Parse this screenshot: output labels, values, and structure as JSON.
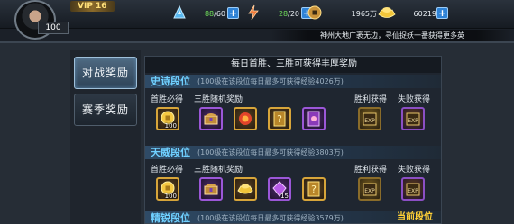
{
  "player": {
    "vip": "VIP 16",
    "level": "100"
  },
  "resources": {
    "stamina": {
      "current": "88",
      "max": "/60",
      "icon": "stamina-icon"
    },
    "energy": {
      "current": "28",
      "max": "/20",
      "icon": "energy-icon"
    },
    "copper": {
      "value": "1965万",
      "icon": "copper-coin-icon"
    },
    "gold": {
      "value": "60219",
      "icon": "gold-ingot-icon"
    },
    "plus": "+"
  },
  "ticker": "神州大地广袤无边，寻仙捉妖一番获得更多英",
  "tabs": {
    "battle": "对战奖励",
    "season": "赛季奖励"
  },
  "main": {
    "title": "每日首胜、三胜可获得丰厚奖励",
    "current_tier_label": "当前段位"
  },
  "tiers": [
    {
      "name": "史诗段位",
      "note": "(100级在该段位每日最多可获得经验4026万)",
      "labels": {
        "first": "首胜必得",
        "three": "三胜随机奖励",
        "win": "胜利获得",
        "lose": "失败获得"
      },
      "first_count": "100",
      "random_counts": [
        "",
        "",
        "",
        ""
      ],
      "win_text": "EXP",
      "lose_text": "EXP"
    },
    {
      "name": "天威段位",
      "note": "(100级在该段位每日最多可获得经验3803万)",
      "labels": {
        "first": "首胜必得",
        "three": "三胜随机奖励",
        "win": "胜利获得",
        "lose": "失败获得"
      },
      "first_count": "100",
      "random_counts": [
        "",
        "",
        "15",
        ""
      ],
      "win_text": "EXP",
      "lose_text": "EXP"
    },
    {
      "name": "精锐段位",
      "note": "(100级在该段位每日最多可获得经验3579万)"
    }
  ],
  "colors": {
    "accent_blue": "#6fd0ff",
    "gold": "#ffd036",
    "plus_button": "#2f83d6"
  }
}
